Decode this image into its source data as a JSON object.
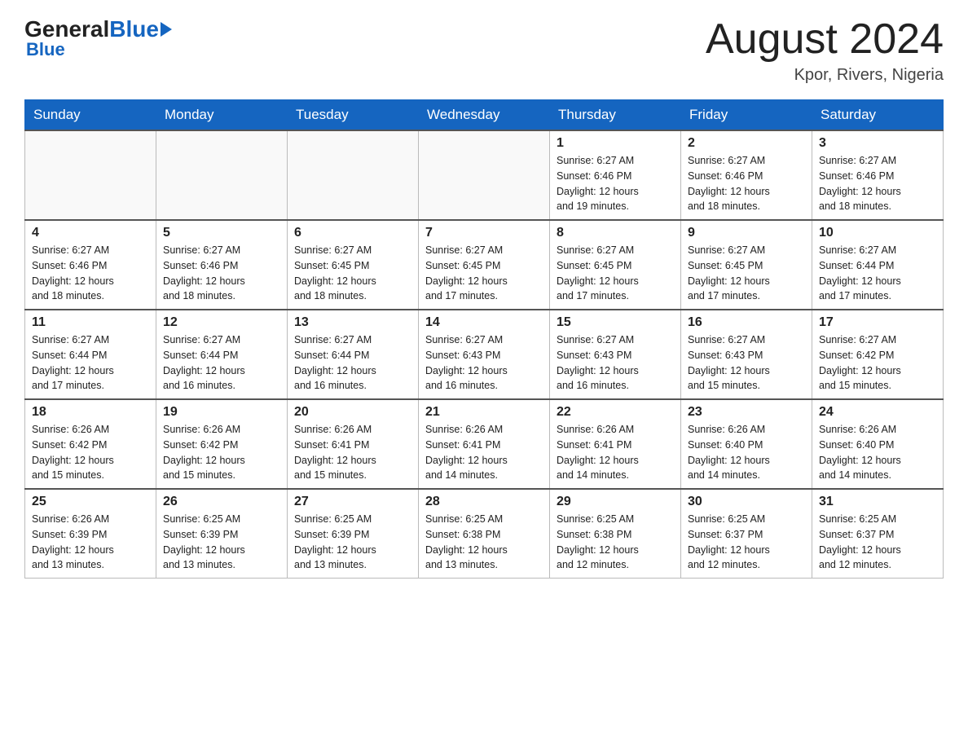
{
  "header": {
    "logo_general": "General",
    "logo_blue": "Blue",
    "month_title": "August 2024",
    "location": "Kpor, Rivers, Nigeria"
  },
  "weekdays": [
    "Sunday",
    "Monday",
    "Tuesday",
    "Wednesday",
    "Thursday",
    "Friday",
    "Saturday"
  ],
  "weeks": [
    [
      {
        "day": "",
        "info": ""
      },
      {
        "day": "",
        "info": ""
      },
      {
        "day": "",
        "info": ""
      },
      {
        "day": "",
        "info": ""
      },
      {
        "day": "1",
        "info": "Sunrise: 6:27 AM\nSunset: 6:46 PM\nDaylight: 12 hours\nand 19 minutes."
      },
      {
        "day": "2",
        "info": "Sunrise: 6:27 AM\nSunset: 6:46 PM\nDaylight: 12 hours\nand 18 minutes."
      },
      {
        "day": "3",
        "info": "Sunrise: 6:27 AM\nSunset: 6:46 PM\nDaylight: 12 hours\nand 18 minutes."
      }
    ],
    [
      {
        "day": "4",
        "info": "Sunrise: 6:27 AM\nSunset: 6:46 PM\nDaylight: 12 hours\nand 18 minutes."
      },
      {
        "day": "5",
        "info": "Sunrise: 6:27 AM\nSunset: 6:46 PM\nDaylight: 12 hours\nand 18 minutes."
      },
      {
        "day": "6",
        "info": "Sunrise: 6:27 AM\nSunset: 6:45 PM\nDaylight: 12 hours\nand 18 minutes."
      },
      {
        "day": "7",
        "info": "Sunrise: 6:27 AM\nSunset: 6:45 PM\nDaylight: 12 hours\nand 17 minutes."
      },
      {
        "day": "8",
        "info": "Sunrise: 6:27 AM\nSunset: 6:45 PM\nDaylight: 12 hours\nand 17 minutes."
      },
      {
        "day": "9",
        "info": "Sunrise: 6:27 AM\nSunset: 6:45 PM\nDaylight: 12 hours\nand 17 minutes."
      },
      {
        "day": "10",
        "info": "Sunrise: 6:27 AM\nSunset: 6:44 PM\nDaylight: 12 hours\nand 17 minutes."
      }
    ],
    [
      {
        "day": "11",
        "info": "Sunrise: 6:27 AM\nSunset: 6:44 PM\nDaylight: 12 hours\nand 17 minutes."
      },
      {
        "day": "12",
        "info": "Sunrise: 6:27 AM\nSunset: 6:44 PM\nDaylight: 12 hours\nand 16 minutes."
      },
      {
        "day": "13",
        "info": "Sunrise: 6:27 AM\nSunset: 6:44 PM\nDaylight: 12 hours\nand 16 minutes."
      },
      {
        "day": "14",
        "info": "Sunrise: 6:27 AM\nSunset: 6:43 PM\nDaylight: 12 hours\nand 16 minutes."
      },
      {
        "day": "15",
        "info": "Sunrise: 6:27 AM\nSunset: 6:43 PM\nDaylight: 12 hours\nand 16 minutes."
      },
      {
        "day": "16",
        "info": "Sunrise: 6:27 AM\nSunset: 6:43 PM\nDaylight: 12 hours\nand 15 minutes."
      },
      {
        "day": "17",
        "info": "Sunrise: 6:27 AM\nSunset: 6:42 PM\nDaylight: 12 hours\nand 15 minutes."
      }
    ],
    [
      {
        "day": "18",
        "info": "Sunrise: 6:26 AM\nSunset: 6:42 PM\nDaylight: 12 hours\nand 15 minutes."
      },
      {
        "day": "19",
        "info": "Sunrise: 6:26 AM\nSunset: 6:42 PM\nDaylight: 12 hours\nand 15 minutes."
      },
      {
        "day": "20",
        "info": "Sunrise: 6:26 AM\nSunset: 6:41 PM\nDaylight: 12 hours\nand 15 minutes."
      },
      {
        "day": "21",
        "info": "Sunrise: 6:26 AM\nSunset: 6:41 PM\nDaylight: 12 hours\nand 14 minutes."
      },
      {
        "day": "22",
        "info": "Sunrise: 6:26 AM\nSunset: 6:41 PM\nDaylight: 12 hours\nand 14 minutes."
      },
      {
        "day": "23",
        "info": "Sunrise: 6:26 AM\nSunset: 6:40 PM\nDaylight: 12 hours\nand 14 minutes."
      },
      {
        "day": "24",
        "info": "Sunrise: 6:26 AM\nSunset: 6:40 PM\nDaylight: 12 hours\nand 14 minutes."
      }
    ],
    [
      {
        "day": "25",
        "info": "Sunrise: 6:26 AM\nSunset: 6:39 PM\nDaylight: 12 hours\nand 13 minutes."
      },
      {
        "day": "26",
        "info": "Sunrise: 6:25 AM\nSunset: 6:39 PM\nDaylight: 12 hours\nand 13 minutes."
      },
      {
        "day": "27",
        "info": "Sunrise: 6:25 AM\nSunset: 6:39 PM\nDaylight: 12 hours\nand 13 minutes."
      },
      {
        "day": "28",
        "info": "Sunrise: 6:25 AM\nSunset: 6:38 PM\nDaylight: 12 hours\nand 13 minutes."
      },
      {
        "day": "29",
        "info": "Sunrise: 6:25 AM\nSunset: 6:38 PM\nDaylight: 12 hours\nand 12 minutes."
      },
      {
        "day": "30",
        "info": "Sunrise: 6:25 AM\nSunset: 6:37 PM\nDaylight: 12 hours\nand 12 minutes."
      },
      {
        "day": "31",
        "info": "Sunrise: 6:25 AM\nSunset: 6:37 PM\nDaylight: 12 hours\nand 12 minutes."
      }
    ]
  ]
}
